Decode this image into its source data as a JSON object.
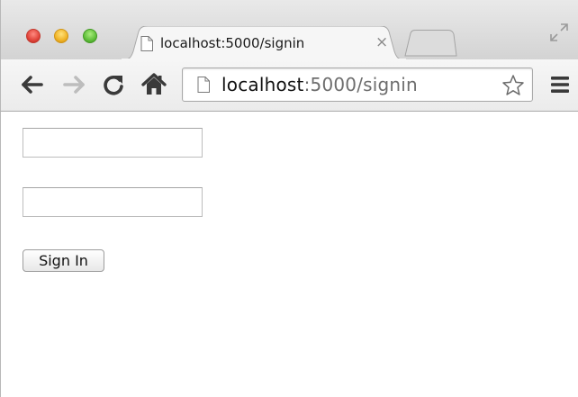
{
  "window": {
    "traffic_lights": [
      "close",
      "minimize",
      "zoom"
    ]
  },
  "tab": {
    "title": "localhost:5000/signin",
    "close_glyph": "×",
    "icon": "page-icon"
  },
  "toolbar": {
    "icons": [
      "back-arrow-icon",
      "forward-arrow-icon",
      "reload-icon",
      "home-icon",
      "star-icon",
      "menu-icon"
    ]
  },
  "omnibox": {
    "host": "localhost",
    "rest": ":5000/signin"
  },
  "form": {
    "username_value": "",
    "password_value": "",
    "submit_label": "Sign In"
  },
  "colors": {
    "tabstrip": "#d3d3d3",
    "toolbar": "#ebebeb",
    "close_red": "#e0443a",
    "minimize_yellow": "#f0b326",
    "zoom_green": "#5fbf3a"
  }
}
